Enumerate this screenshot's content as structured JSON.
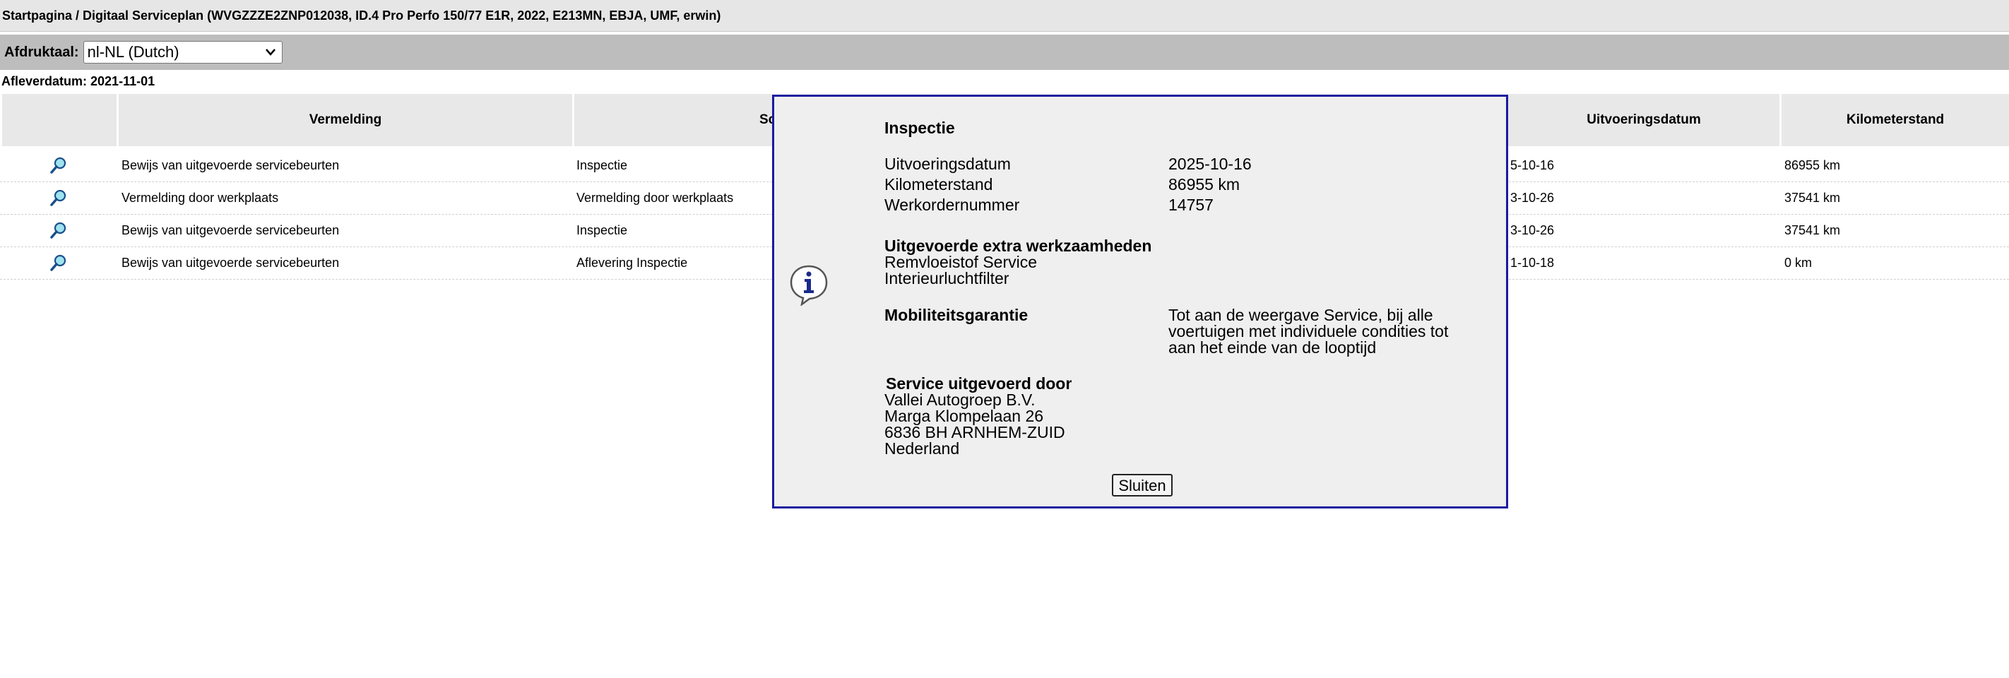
{
  "breadcrumb": "Startpagina / Digitaal Serviceplan (WVGZZZE2ZNP012038, ID.4 Pro Perfo 150/77 E1R, 2022, E213MN, EBJA, UMF, erwin)",
  "print_language": {
    "label": "Afdruktaal:",
    "selected": "nl-NL (Dutch)"
  },
  "delivery_date": "Afleverdatum: 2021-11-01",
  "table": {
    "headers": {
      "entry": "Vermelding",
      "service_partial": "Sc",
      "date": "Uitvoeringsdatum",
      "mileage": "Kilometerstand"
    },
    "rows": [
      {
        "entry": "Bewijs van uitgevoerde servicebeurten",
        "service": "Inspectie",
        "date": "5-10-16",
        "mileage": "86955 km"
      },
      {
        "entry": "Vermelding door werkplaats",
        "service": "Vermelding door werkplaats",
        "date": "3-10-26",
        "mileage": "37541 km"
      },
      {
        "entry": "Bewijs van uitgevoerde servicebeurten",
        "service": "Inspectie",
        "date": "3-10-26",
        "mileage": "37541 km"
      },
      {
        "entry": "Bewijs van uitgevoerde servicebeurten",
        "service": "Aflevering Inspectie",
        "date": "1-10-18",
        "mileage": "0 km"
      }
    ]
  },
  "modal": {
    "title": "Inspectie",
    "fields": [
      {
        "label": "Uitvoeringsdatum",
        "value": "2025-10-16"
      },
      {
        "label": "Kilometerstand",
        "value": "86955 km"
      },
      {
        "label": "Werkordernummer",
        "value": "14757"
      }
    ],
    "extra_work": {
      "title": "Uitgevoerde extra werkzaamheden",
      "items": [
        "Remvloeistof Service",
        "Interieurluchtfilter"
      ]
    },
    "mobility": {
      "label": "Mobiliteitsgarantie",
      "lines": [
        "Tot aan de weergave Service, bij alle",
        "voertuigen met individuele condities tot",
        "aan het einde van de looptijd"
      ]
    },
    "performed_by": {
      "title": "Service uitgevoerd door",
      "lines": [
        "Vallei Autogroep B.V.",
        "Marga Klompelaan 26",
        "6836 BH ARNHEM-ZUID",
        "Nederland"
      ]
    },
    "close_label": "Sluiten"
  },
  "icons": {
    "row_action": "magnifier-icon",
    "modal": "info-icon"
  },
  "colors": {
    "modal_border": "#1a1aa0",
    "header_bg": "#e8e8e8",
    "lang_bar": "#bdbdbd"
  }
}
